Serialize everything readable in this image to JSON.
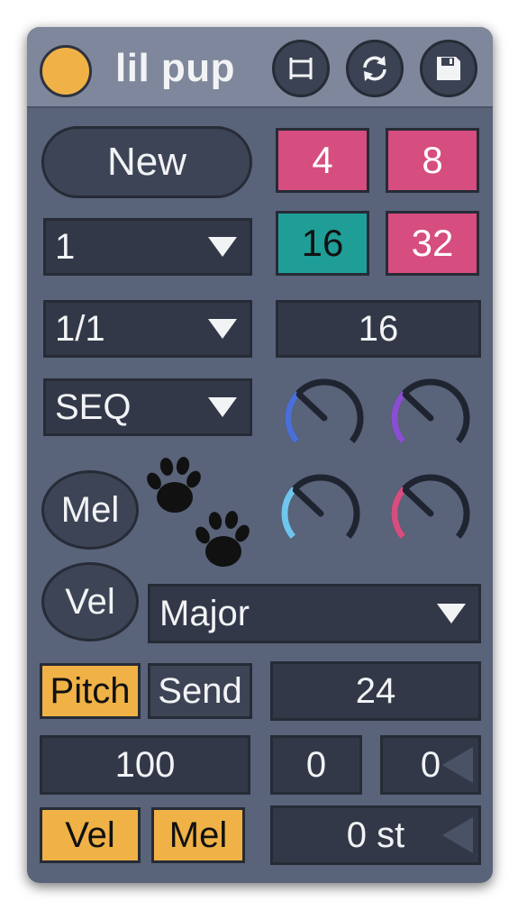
{
  "header": {
    "title": "lil pup",
    "buttons": [
      {
        "icon": "clip-icon"
      },
      {
        "icon": "sync-icon"
      },
      {
        "icon": "save-icon"
      }
    ]
  },
  "controls": {
    "new_label": "New",
    "length_value": "1",
    "rate_value": "1/1",
    "mode_value": "SEQ",
    "steps_value": "16",
    "scale_value": "Major",
    "mel_circle_label": "Mel",
    "vel_circle_label": "Vel",
    "pitch_label": "Pitch",
    "send_label": "Send",
    "range_value": "24",
    "velocity_value": "100",
    "num_a": "0",
    "num_b": "0",
    "transpose_value": "0 st",
    "vel_toggle": "Vel",
    "mel_toggle": "Mel"
  },
  "pads": [
    {
      "label": "4",
      "color": "#d64d7f",
      "text_color": "#ffffff"
    },
    {
      "label": "8",
      "color": "#d64d7f",
      "text_color": "#ffffff"
    },
    {
      "label": "16",
      "color": "#1f9e98",
      "text_color": "#111111"
    },
    {
      "label": "32",
      "color": "#d64d7f",
      "text_color": "#ffffff"
    }
  ],
  "knobs": [
    {
      "color": "#4a6fd6",
      "value": 0.32
    },
    {
      "color": "#8a4fd1",
      "value": 0.32
    },
    {
      "color": "#6ec6ee",
      "value": 0.32
    },
    {
      "color": "#d64d7f",
      "value": 0.32
    }
  ],
  "colors": {
    "accent": "#f0b246",
    "panel": "#596379",
    "field": "#323848"
  }
}
